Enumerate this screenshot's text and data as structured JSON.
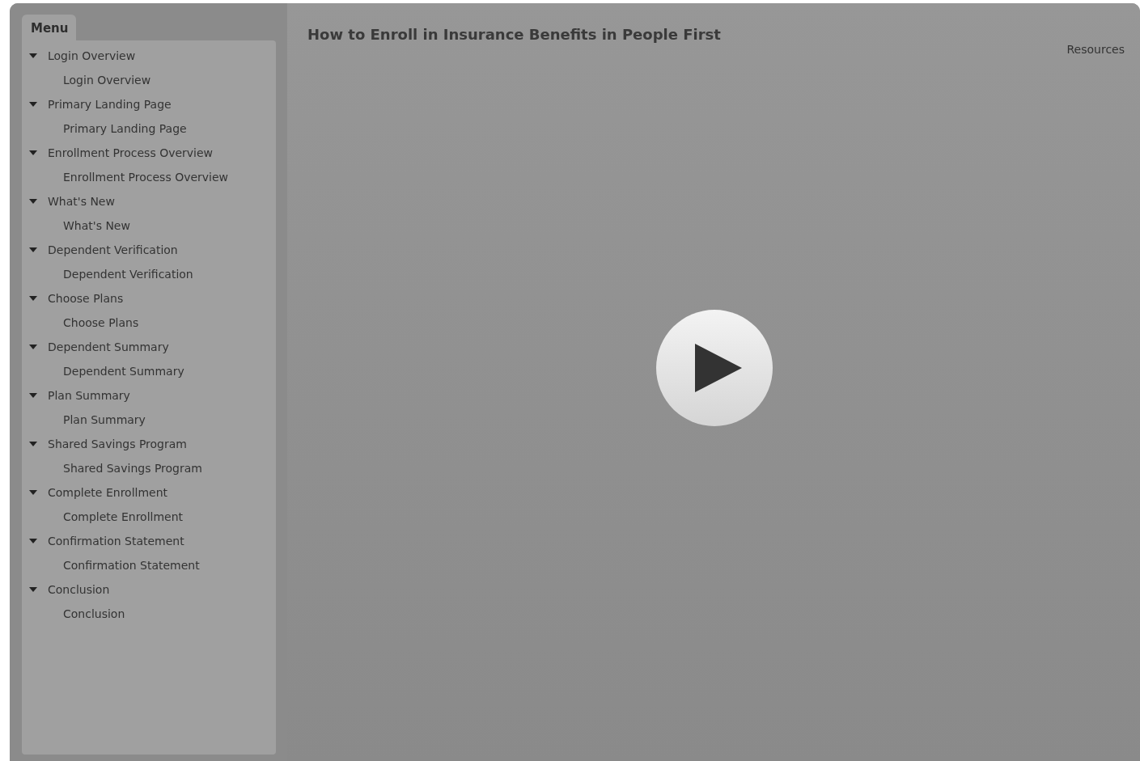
{
  "menu": {
    "title": "Menu",
    "items": [
      {
        "label": "Login Overview",
        "expanded": true,
        "children": [
          {
            "label": "Login Overview"
          }
        ]
      },
      {
        "label": "Primary Landing Page",
        "expanded": true,
        "children": [
          {
            "label": "Primary Landing Page"
          }
        ]
      },
      {
        "label": "Enrollment Process Overview",
        "expanded": true,
        "children": [
          {
            "label": "Enrollment Process Overview"
          }
        ]
      },
      {
        "label": "What's New",
        "expanded": true,
        "children": [
          {
            "label": "What's New"
          }
        ]
      },
      {
        "label": "Dependent Verification",
        "expanded": true,
        "children": [
          {
            "label": "Dependent Verification"
          }
        ]
      },
      {
        "label": "Choose Plans",
        "expanded": true,
        "children": [
          {
            "label": "Choose Plans"
          }
        ]
      },
      {
        "label": "Dependent Summary",
        "expanded": true,
        "children": [
          {
            "label": "Dependent Summary"
          }
        ]
      },
      {
        "label": "Plan Summary",
        "expanded": true,
        "children": [
          {
            "label": "Plan Summary"
          }
        ]
      },
      {
        "label": "Shared Savings Program",
        "expanded": true,
        "children": [
          {
            "label": "Shared Savings Program"
          }
        ]
      },
      {
        "label": "Complete Enrollment",
        "expanded": true,
        "children": [
          {
            "label": "Complete Enrollment"
          }
        ]
      },
      {
        "label": "Confirmation Statement",
        "expanded": true,
        "children": [
          {
            "label": "Confirmation Statement"
          }
        ]
      },
      {
        "label": "Conclusion",
        "expanded": true,
        "children": [
          {
            "label": "Conclusion"
          }
        ]
      }
    ]
  },
  "main": {
    "title": "How to Enroll in Insurance Benefits in People First",
    "resources": "Resources"
  }
}
